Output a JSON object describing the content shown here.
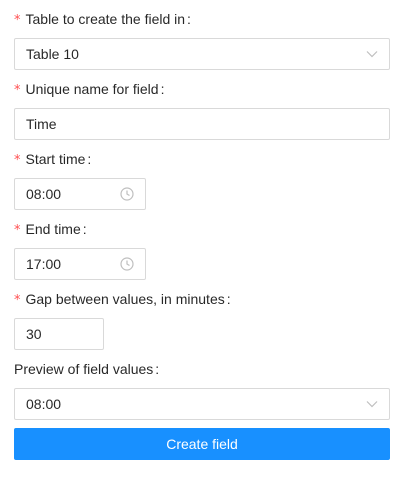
{
  "form": {
    "table": {
      "label": "Table to create the field in",
      "required": true,
      "value": "Table 10"
    },
    "field_name": {
      "label": "Unique name for field",
      "required": true,
      "value": "Time"
    },
    "start_time": {
      "label": "Start time",
      "required": true,
      "value": "08:00"
    },
    "end_time": {
      "label": "End time",
      "required": true,
      "value": "17:00"
    },
    "gap": {
      "label": "Gap between values, in minutes",
      "required": true,
      "value": "30"
    },
    "preview": {
      "label": "Preview of field values",
      "required": false,
      "value": "08:00"
    },
    "submit_label": "Create field"
  },
  "required_mark": "*",
  "colon": ":",
  "colors": {
    "primary": "#1890ff",
    "required": "#ff4d4f",
    "border": "#d9d9d9"
  },
  "icons": {
    "select_arrow": "chevron-down-icon",
    "time": "clock-icon"
  }
}
